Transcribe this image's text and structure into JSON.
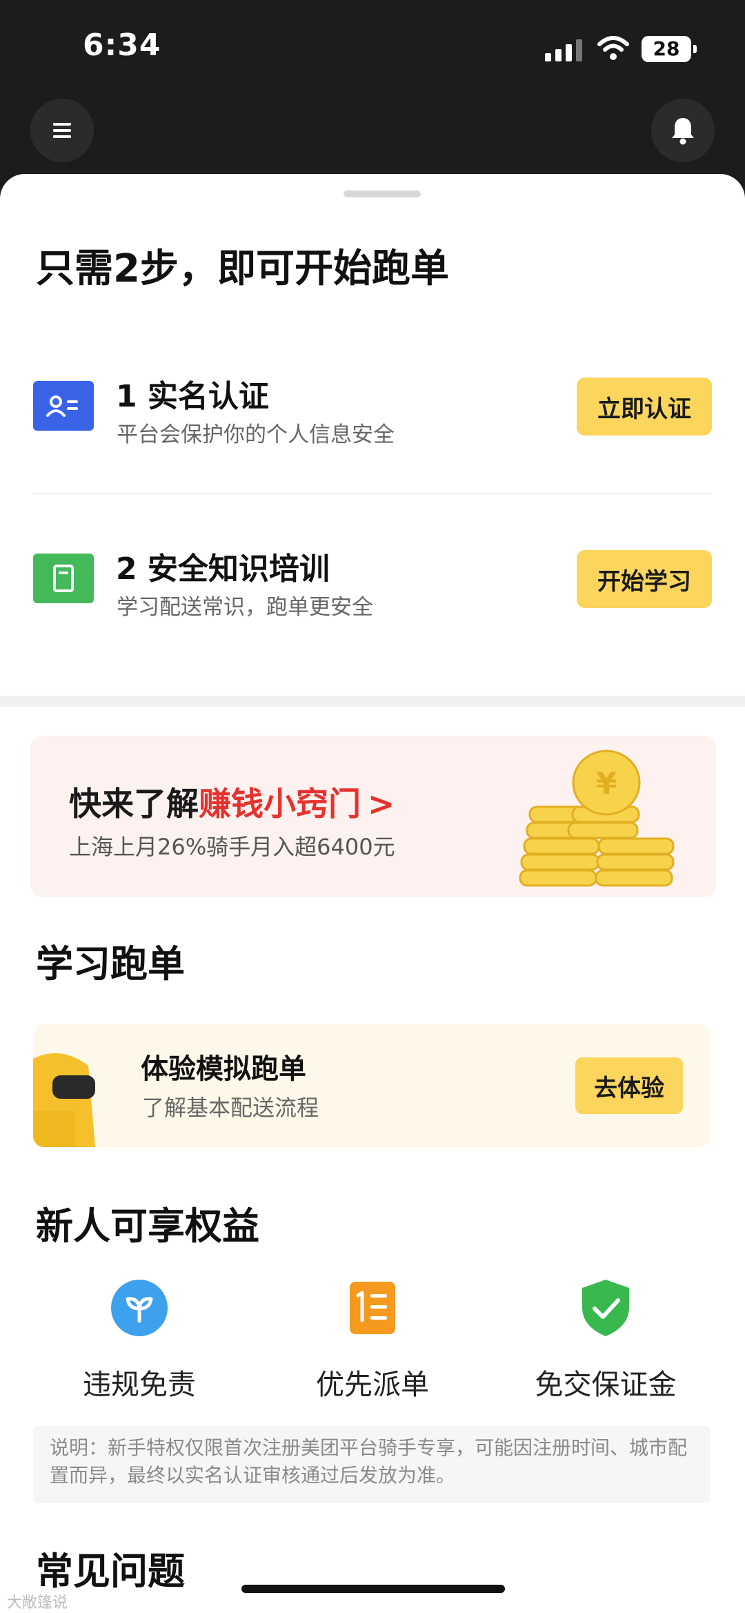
{
  "status_bar": {
    "time": "6:34",
    "battery": "28"
  },
  "steps": {
    "title": "只需2步，即可开始跑单",
    "items": [
      {
        "title": "1 实名认证",
        "subtitle": "平台会保护你的个人信息安全",
        "button": "立即认证",
        "icon": "id-card-icon",
        "color": "#3a63e8"
      },
      {
        "title": "2 安全知识培训",
        "subtitle": "学习配送常识，跑单更安全",
        "button": "开始学习",
        "icon": "document-icon",
        "color": "#43b95a"
      }
    ]
  },
  "banner": {
    "title_prefix": "快来了解",
    "title_highlight": "赚钱小窍门",
    "arrow": ">",
    "subtitle": "上海上月26%骑手月入超6400元"
  },
  "learn": {
    "heading": "学习跑单",
    "card_title": "体验模拟跑单",
    "card_subtitle": "了解基本配送流程",
    "button": "去体验"
  },
  "perks": {
    "heading": "新人可享权益",
    "items": [
      {
        "label": "违规免责",
        "icon": "sprout-icon",
        "color": "#3ea1ee"
      },
      {
        "label": "优先派单",
        "icon": "list-priority-icon",
        "color": "#f59a1e"
      },
      {
        "label": "免交保证金",
        "icon": "shield-check-icon",
        "color": "#38b84f"
      }
    ],
    "note": "说明：新手特权仅限首次注册美团平台骑手专享，可能因注册时间、城市配置而异，最终以实名认证审核通过后发放为准。"
  },
  "faq": {
    "heading": "常见问题"
  },
  "watermark": "大敞篷说"
}
